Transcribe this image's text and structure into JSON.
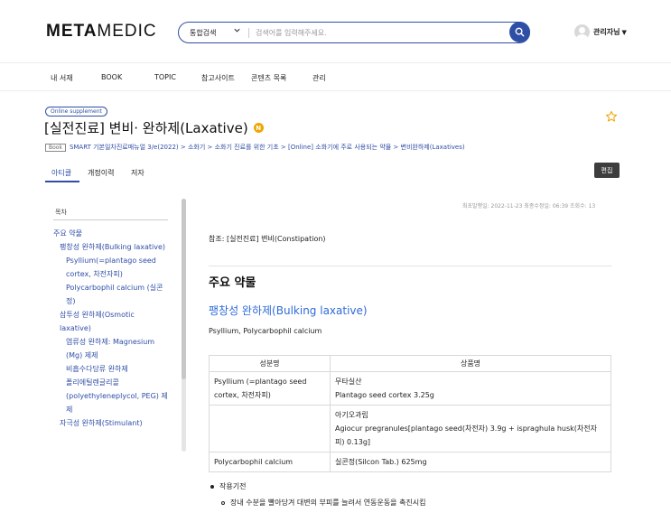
{
  "header": {
    "logo_bold": "META",
    "logo_light": "MEDIC",
    "search": {
      "scope": "통합검색",
      "placeholder": "검색어를 입력해주세요."
    },
    "user": {
      "name": "관리자님",
      "caret": "▼"
    }
  },
  "nav": {
    "items": [
      "내 서재",
      "BOOK",
      "TOPIC",
      "참고사이트",
      "콘텐츠 목록",
      "관리"
    ]
  },
  "article": {
    "badge": "Online supplement",
    "title": "[실전진료] 변비· 완하제(Laxative)",
    "title_icon": "N",
    "breadcrumb_badge": "Book",
    "breadcrumb": "SMART 기본일차진료매뉴얼 3/e(2022) > 소화기 > 소화기 진료를 위한 기초 > [Online] 소화기에 주로 사용되는 약물 > 변비완하제(Laxatives)",
    "meta": "최초발행일: 2022-11-23   최종수정일: 06:39   조회수: 13"
  },
  "tabs": {
    "items": [
      "아티클",
      "개정이력",
      "저자"
    ],
    "active": 0,
    "edit": "편집"
  },
  "toc": {
    "heading": "목차",
    "items": [
      {
        "level": 1,
        "text": "주요 약물"
      },
      {
        "level": 2,
        "text": "팽창성 완하제(Bulking laxative)"
      },
      {
        "level": 3,
        "text": "Psyllium(=plantago seed cortex, 차전자피)"
      },
      {
        "level": 3,
        "text": "Polycarbophil calcium (실콘정)"
      },
      {
        "level": 2,
        "text": "삼투성 완하제(Osmotic laxative)"
      },
      {
        "level": 3,
        "text": "염류성 완하제: Magnesium (Mg) 제제"
      },
      {
        "level": 3,
        "text": "비흡수다당류 완하제"
      },
      {
        "level": 3,
        "text": "폴리에틸렌글리콜(polyethyleneplycol, PEG) 제제"
      },
      {
        "level": 2,
        "text": "자극성 완하제(Stimulant)"
      }
    ]
  },
  "content": {
    "reference": "참조: [실전진료] 변비(Constipation)",
    "h2": "주요 약물",
    "h3": "팽창성 완하제(Bulking laxative)",
    "para": "Psyllium, Polycarbophil calcium",
    "table": {
      "headers": [
        "성분명",
        "상품명"
      ],
      "rows": [
        {
          "ingredient": "Psyllium (=plantago seed cortex, 차전자피)",
          "products": [
            "무타실산",
            "Plantago seed cortex 3.25g"
          ]
        },
        {
          "ingredient": "",
          "products": [
            "아기오과립",
            "Agiocur pregranules[plantago seed(차전자) 3.9g + ispraghula husk(차전자피) 0.13g]"
          ]
        },
        {
          "ingredient": "Polycarbophil calcium",
          "products": [
            "실콘정(Silcon Tab.) 625mg"
          ]
        }
      ]
    },
    "bullet": "작용기전",
    "subbullet": "장내 수분을 빨아당겨 대변의 부피를 늘려서 연동운동을 촉진시킴"
  },
  "colors": {
    "brand": "#2f4ea6",
    "link": "#2f6bd8",
    "star": "#f0a500"
  },
  "icons": [
    "search-icon",
    "chevron-down-icon",
    "avatar",
    "star-icon",
    "new-badge-icon"
  ]
}
